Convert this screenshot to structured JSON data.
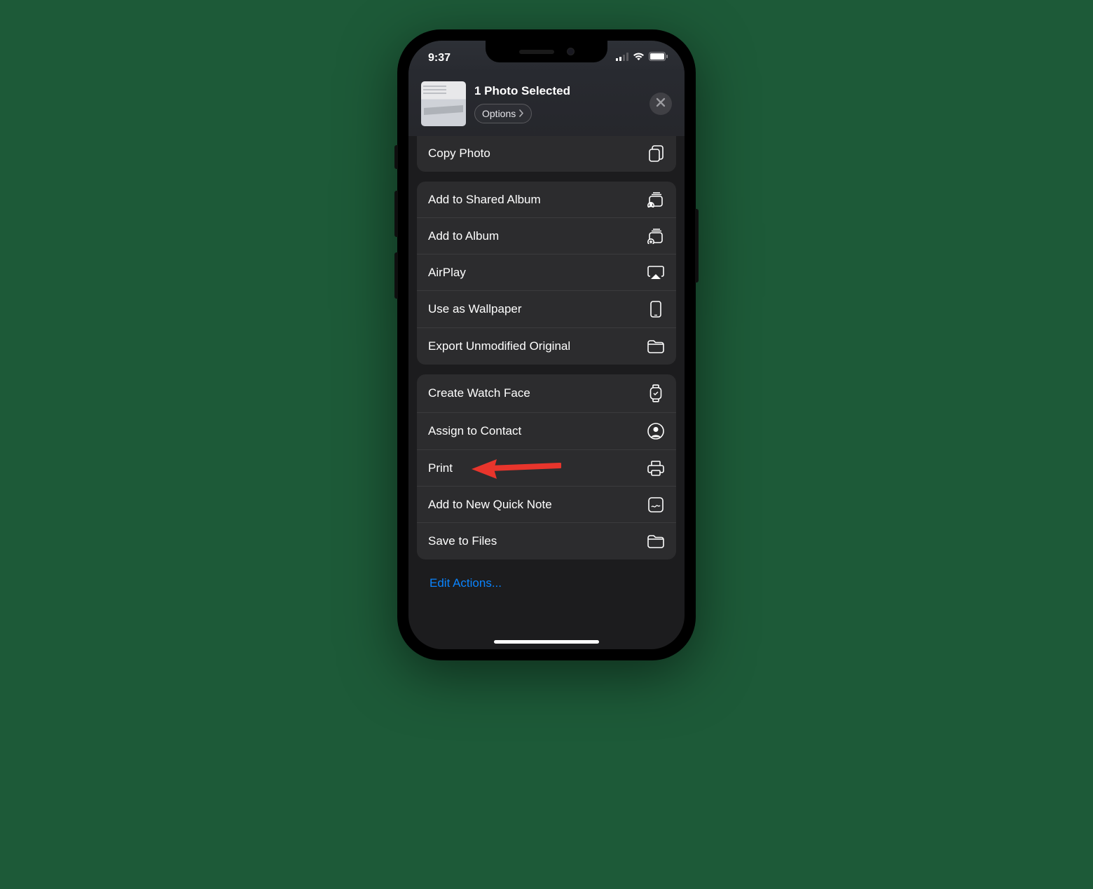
{
  "status": {
    "time": "9:37"
  },
  "header": {
    "title": "1 Photo Selected",
    "options_label": "Options"
  },
  "group1": {
    "copy_photo": "Copy Photo"
  },
  "group2": {
    "add_shared_album": "Add to Shared Album",
    "add_album": "Add to Album",
    "airplay": "AirPlay",
    "wallpaper": "Use as Wallpaper",
    "export_original": "Export Unmodified Original"
  },
  "group3": {
    "watch_face": "Create Watch Face",
    "assign_contact": "Assign to Contact",
    "print": "Print",
    "quick_note": "Add to New Quick Note",
    "save_files": "Save to Files"
  },
  "footer": {
    "edit_actions": "Edit Actions..."
  }
}
